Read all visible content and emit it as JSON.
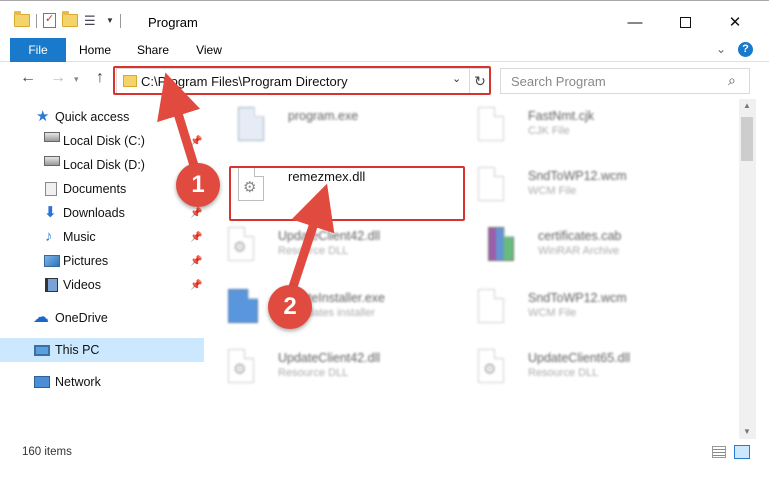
{
  "window": {
    "title": "Program",
    "minimize_glyph": "—",
    "close_glyph": "✕"
  },
  "ribbon": {
    "tabs": [
      {
        "label": "File"
      },
      {
        "label": "Home"
      },
      {
        "label": "Share"
      },
      {
        "label": "View"
      }
    ],
    "chevron_glyph": "⌄",
    "help_glyph": "?"
  },
  "nav": {
    "back_glyph": "←",
    "forward_glyph": "→",
    "recent_glyph": "▾",
    "up_glyph": "↑",
    "address": "C:\\Program Files\\Program Directory",
    "dropdown_glyph": "⌄",
    "refresh_glyph": "↻",
    "search_placeholder": "Search Program",
    "search_glyph": "⌕"
  },
  "sidebar": {
    "items": [
      {
        "label": "Quick access",
        "icon": "star-icon",
        "pinned": false
      },
      {
        "label": "Local Disk (C:)",
        "icon": "disk-icon",
        "pinned": true
      },
      {
        "label": "Local Disk (D:)",
        "icon": "disk-icon",
        "pinned": false
      },
      {
        "label": "Documents",
        "icon": "documents-icon",
        "pinned": true
      },
      {
        "label": "Downloads",
        "icon": "downloads-icon",
        "pinned": true
      },
      {
        "label": "Music",
        "icon": "music-icon",
        "pinned": true
      },
      {
        "label": "Pictures",
        "icon": "pictures-icon",
        "pinned": true
      },
      {
        "label": "Videos",
        "icon": "videos-icon",
        "pinned": true
      },
      {
        "label": "OneDrive",
        "icon": "onedrive-icon",
        "pinned": false
      },
      {
        "label": "This PC",
        "icon": "this-pc-icon",
        "pinned": false,
        "selected": true
      },
      {
        "label": "Network",
        "icon": "network-icon",
        "pinned": false
      }
    ],
    "pin_glyph": "📌",
    "star_glyph": "★",
    "download_glyph": "⬇",
    "music_glyph": "♪",
    "cloud_glyph": "☁"
  },
  "files": [
    {
      "name": "program.exe",
      "type": "",
      "icon": "exe-icon"
    },
    {
      "name": "FastNmt.cjk",
      "type": "CJK File",
      "icon": "file-icon"
    },
    {
      "name": "remezmex.dll",
      "type": "",
      "icon": "dll-gear-icon",
      "highlighted": true
    },
    {
      "name": "SndToWP12.wcm",
      "type": "WCM File",
      "icon": "file-icon"
    },
    {
      "name": "UpdateClient42.dll",
      "type": "Resource DLL",
      "icon": "dll-gear-icon"
    },
    {
      "name": "certificates.cab",
      "type": "WinRAR Archive",
      "icon": "rar-icon"
    },
    {
      "name": "UpdateInstaller.exe",
      "type": "FY updates installer",
      "icon": "installer-icon"
    },
    {
      "name": "SndToWP12.wcm",
      "type": "WCM File",
      "icon": "file-icon"
    },
    {
      "name": "UpdateClient42.dll",
      "type": "Resource DLL",
      "icon": "dll-gear-icon"
    },
    {
      "name": "UpdateClient65.dll",
      "type": "Resource DLL",
      "icon": "dll-gear-icon"
    }
  ],
  "status": {
    "item_count": "160 items"
  },
  "callouts": [
    {
      "label": "1",
      "color": "#e04a3f"
    },
    {
      "label": "2",
      "color": "#e04a3f"
    }
  ],
  "colors": {
    "accent": "#1979ca",
    "highlight": "#d9332f",
    "selection": "#cce8ff"
  },
  "scrollbar": {
    "up_glyph": "▲",
    "down_glyph": "▼"
  }
}
